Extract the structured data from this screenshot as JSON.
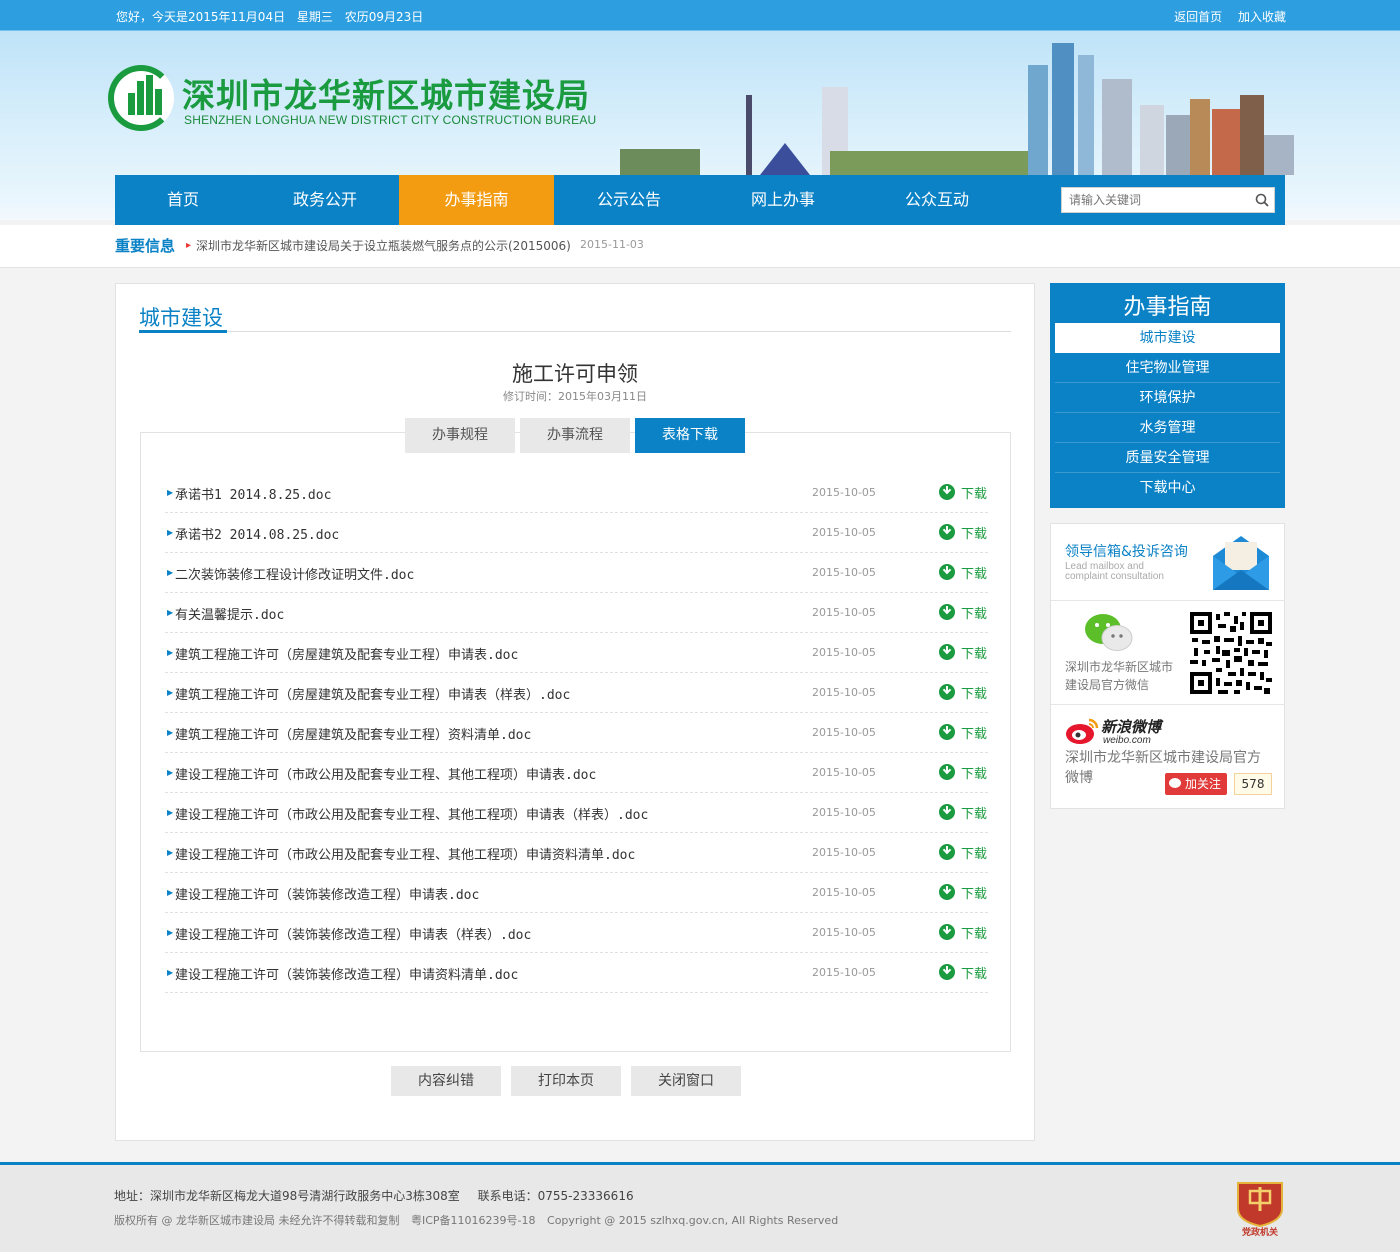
{
  "topbar": {
    "greeting": "您好，今天是2015年11月04日",
    "weekday": "星期三",
    "lunar": "农历09月23日",
    "home_link": "返回首页",
    "bookmark_link": "加入收藏"
  },
  "logo": {
    "cn": "深圳市龙华新区城市建设局",
    "en": "SHENZHEN  LONGHUA  NEW  DISTRICT  CITY  CONSTRUCTION  BUREAU"
  },
  "nav": {
    "items": [
      "首页",
      "政务公开",
      "办事指南",
      "公示公告",
      "网上办事",
      "公众互动"
    ],
    "active_index": 2,
    "search_placeholder": "请输入关键词"
  },
  "notice": {
    "label": "重要信息",
    "text": "深圳市龙华新区城市建设局关于设立瓶装燃气服务点的公示(2015006)",
    "date": "2015-11-03"
  },
  "main": {
    "section_title": "城市建设",
    "doc_title": "施工许可申领",
    "doc_date": "修订时间：2015年03月11日",
    "tabs": [
      "办事规程",
      "办事流程",
      "表格下载"
    ],
    "active_tab": 2,
    "download_label": "下载",
    "files": [
      {
        "name": "承诺书1 2014.8.25.doc",
        "date": "2015-10-05"
      },
      {
        "name": "承诺书2 2014.08.25.doc",
        "date": "2015-10-05"
      },
      {
        "name": "二次装饰装修工程设计修改证明文件.doc",
        "date": "2015-10-05"
      },
      {
        "name": "有关温馨提示.doc",
        "date": "2015-10-05"
      },
      {
        "name": "建筑工程施工许可（房屋建筑及配套专业工程）申请表.doc",
        "date": "2015-10-05"
      },
      {
        "name": "建筑工程施工许可（房屋建筑及配套专业工程）申请表（样表）.doc",
        "date": "2015-10-05"
      },
      {
        "name": "建筑工程施工许可（房屋建筑及配套专业工程）资料清单.doc",
        "date": "2015-10-05"
      },
      {
        "name": "建设工程施工许可（市政公用及配套专业工程、其他工程项）申请表.doc",
        "date": "2015-10-05"
      },
      {
        "name": "建设工程施工许可（市政公用及配套专业工程、其他工程项）申请表（样表）.doc",
        "date": "2015-10-05"
      },
      {
        "name": "建设工程施工许可（市政公用及配套专业工程、其他工程项）申请资料清单.doc",
        "date": "2015-10-05"
      },
      {
        "name": "建设工程施工许可（装饰装修改造工程）申请表.doc",
        "date": "2015-10-05"
      },
      {
        "name": "建设工程施工许可（装饰装修改造工程）申请表（样表）.doc",
        "date": "2015-10-05"
      },
      {
        "name": "建设工程施工许可（装饰装修改造工程）申请资料清单.doc",
        "date": "2015-10-05"
      }
    ],
    "actions": [
      "内容纠错",
      "打印本页",
      "关闭窗口"
    ]
  },
  "sidebar": {
    "title": "办事指南",
    "items": [
      "城市建设",
      "住宅物业管理",
      "环境保护",
      "水务管理",
      "质量安全管理",
      "下载中心"
    ],
    "active_index": 0,
    "mailbox_title": "领导信箱&投诉咨询",
    "mailbox_en": "Lead mailbox and complaint consultation",
    "wechat_text": "深圳市龙华新区城市建设局官方微信",
    "weibo_logo": "新浪微博",
    "weibo_domain": "weibo.com",
    "weibo_text": "深圳市龙华新区城市建设局官方微博",
    "follow_label": "加关注",
    "follow_count": "578"
  },
  "footer": {
    "address": "地址：深圳市龙华新区梅龙大道98号清湖行政服务中心3栋308室",
    "phone": "联系电话：0755-23336616",
    "copyright": "版权所有 @ 龙华新区城市建设局 未经允许不得转载和复制",
    "icp": "粤ICP备11016239号-18",
    "copyright_en": "Copyright @ 2015 szlhxq.gov.cn, All Rights Reserved",
    "badge_text": "党政机关"
  },
  "colors": {
    "primary": "#0b82c6",
    "accent": "#f39c12",
    "green": "#1a9b3f"
  }
}
